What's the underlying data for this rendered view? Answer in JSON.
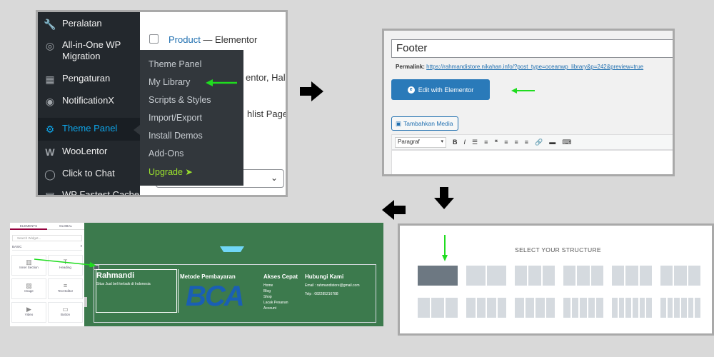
{
  "wp_admin": {
    "menu": [
      {
        "icon": "wrench-icon",
        "glyph": "🔧",
        "label": "Peralatan"
      },
      {
        "icon": "migration-icon",
        "glyph": "◎",
        "label": "All-in-One WP Migration"
      },
      {
        "icon": "settings-icon",
        "glyph": "▦",
        "label": "Pengaturan"
      },
      {
        "icon": "notification-icon",
        "glyph": "◉",
        "label": "NotificationX"
      },
      {
        "icon": "gear-icon",
        "glyph": "⚙",
        "label": "Theme Panel"
      },
      {
        "icon": "woolentor-icon",
        "glyph": "W",
        "label": "WooLentor"
      },
      {
        "icon": "whatsapp-icon",
        "glyph": "◯",
        "label": "Click to Chat"
      },
      {
        "icon": "cache-icon",
        "glyph": "▤",
        "label": "WP Fastest Cache"
      }
    ],
    "flyout": [
      "Theme Panel",
      "My Library",
      "Scripts & Styles",
      "Import/Export",
      "Install Demos",
      "Add-Ons",
      "Upgrade ➤"
    ],
    "content": {
      "product_link": "Product",
      "product_suffix": " — Elementor",
      "row2": "entor, Halam",
      "row3": "hlist Page"
    }
  },
  "post_editor": {
    "title_value": "Footer",
    "permalink_label": "Permalink:",
    "permalink_url": "https://rahmandistore.nikahan.info/?post_type=oceanwp_library&p=242&preview=true",
    "edit_button": "Edit with Elementor",
    "media_button": "Tambahkan Media",
    "format_select": "Paragraf",
    "toolbar_icons": [
      "B",
      "I",
      "☰",
      "≡",
      "❝",
      "≡",
      "≡",
      "≡",
      "🔗",
      "▬",
      "⌨"
    ]
  },
  "structure": {
    "title": "SELECT YOUR STRUCTURE",
    "row1_cols": [
      1,
      2,
      3,
      3,
      3,
      3
    ],
    "row2_cols": [
      3,
      4,
      4,
      5,
      6,
      6
    ]
  },
  "elementor": {
    "tabs": [
      "ELEMENTS",
      "GLOBAL"
    ],
    "search_placeholder": "Search Widget...",
    "category": "BASIC",
    "widgets": [
      {
        "label": "Inner Section",
        "glyph": "▥"
      },
      {
        "label": "Heading",
        "glyph": "T"
      },
      {
        "label": "Image",
        "glyph": "▨"
      },
      {
        "label": "Text Editor",
        "glyph": "≡"
      },
      {
        "label": "Video",
        "glyph": "▶"
      },
      {
        "label": "Button",
        "glyph": "▭"
      }
    ],
    "footer": {
      "brand": "Rahmandi",
      "tagline": "Situs Jual beli terbaik di Indonesia",
      "payment_title": "Metode Pembayaran",
      "payment_logo": "BCA",
      "links_title": "Akses Cepat",
      "links": [
        "Home",
        "Blog",
        "Shop",
        "Lacak Pesanan",
        "Account"
      ],
      "contact_title": "Hubungi Kami",
      "email": "Email : rahmandistore@gmail.com",
      "phone": "Telp : 082285216788"
    }
  },
  "colors": {
    "wp_sidebar": "#23282d",
    "wp_active": "#0ea5e9",
    "upgrade": "#9be22d",
    "elementor_blue": "#2a7ab9",
    "footer_green": "#3c7a4d",
    "pointer_green": "#1fdc1f"
  }
}
